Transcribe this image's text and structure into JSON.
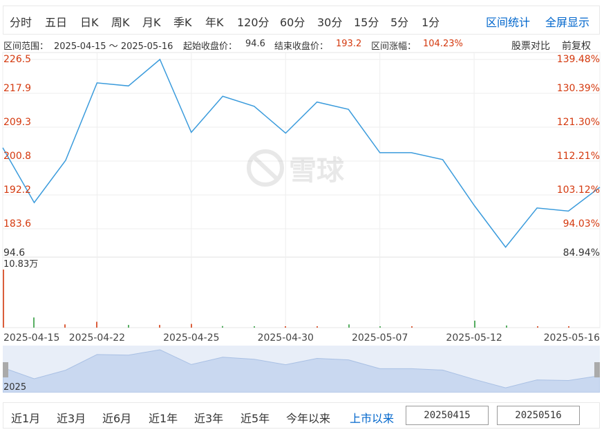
{
  "period_tabs": [
    "分时",
    "五日",
    "日K",
    "周K",
    "月K",
    "季K",
    "年K",
    "120分",
    "60分",
    "30分",
    "15分",
    "5分",
    "1分"
  ],
  "actions": {
    "range_stats": "区间统计",
    "fullscreen": "全屏显示"
  },
  "info": {
    "range_label": "区间范围：",
    "range_value": "2025-04-15 ～ 2025-05-16",
    "start_label": "起始收盘价：",
    "start_value": "94.6",
    "end_label": "结束收盘价：",
    "end_value": "193.2",
    "change_label": "区间涨幅：",
    "change_value": "104.23%",
    "compare": "股票对比",
    "adjust": "前复权"
  },
  "watermark": "雪球",
  "colors": {
    "line": "#3a9bdc",
    "up": "#d4380d",
    "down": "#2e9b3c",
    "accent": "#0066cc",
    "navigator": "#c9d8f0"
  },
  "chart_data": {
    "type": "line",
    "y_ticks_left": [
      "226.5",
      "217.9",
      "209.3",
      "200.8",
      "192.2",
      "183.6",
      "94.6"
    ],
    "y_ticks_right": [
      "139.48%",
      "130.39%",
      "121.30%",
      "112.21%",
      "103.12%",
      "94.03%",
      "84.94%"
    ],
    "x_ticks": [
      "2025-04-15",
      "2025-04-22",
      "2025-04-25",
      "2025-04-30",
      "2025-05-07",
      "2025-05-12",
      "2025-05-16"
    ],
    "ylim": [
      175.0,
      226.5
    ],
    "series": [
      {
        "values": [
          203.5,
          189.2,
          200.2,
          220.4,
          219.6,
          226.5,
          207.5,
          216.9,
          214.3,
          207.3,
          215.4,
          213.5,
          202.2,
          202.2,
          200.4,
          188.5,
          177.6,
          187.8,
          187.0,
          193.2
        ]
      }
    ],
    "volume_label": "10.83万",
    "volume": [
      {
        "v": 10.83,
        "dir": "up"
      },
      {
        "v": 1.9,
        "dir": "down"
      },
      {
        "v": 0.6,
        "dir": "up"
      },
      {
        "v": 1.1,
        "dir": "up"
      },
      {
        "v": 0.5,
        "dir": "down"
      },
      {
        "v": 0.5,
        "dir": "up"
      },
      {
        "v": 0.7,
        "dir": "up"
      },
      {
        "v": 0.3,
        "dir": "down"
      },
      {
        "v": 0.2,
        "dir": "down"
      },
      {
        "v": 0.15,
        "dir": "up"
      },
      {
        "v": 0.15,
        "dir": "up"
      },
      {
        "v": 0.6,
        "dir": "down"
      },
      {
        "v": 0.2,
        "dir": "down"
      },
      {
        "v": 0.15,
        "dir": "up"
      },
      {
        "v": 1.3,
        "dir": "down"
      },
      {
        "v": 0.4,
        "dir": "down"
      },
      {
        "v": 0.2,
        "dir": "up"
      },
      {
        "v": 0.15,
        "dir": "up"
      }
    ],
    "grid": true
  },
  "navigator": {
    "year": "2025"
  },
  "range_tabs": [
    "近1月",
    "近3月",
    "近6月",
    "近1年",
    "近3年",
    "近5年",
    "今年以来",
    "上市以来"
  ],
  "range_active": "上市以来",
  "date_from": "20250415",
  "date_to": "20250516"
}
